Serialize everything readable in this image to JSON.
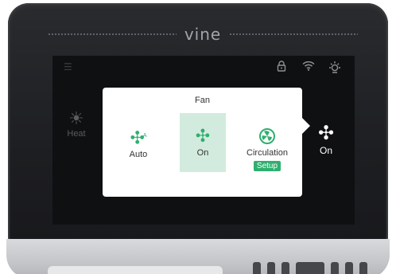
{
  "brand": {
    "name": "vine"
  },
  "status_bar": {
    "icons": [
      "menu-icon",
      "lock-icon",
      "wifi-icon",
      "sun-icon"
    ]
  },
  "left_mode": {
    "label": "Heat",
    "icon": "sun-icon"
  },
  "right_fan": {
    "label": "On",
    "icon": "fan-icon"
  },
  "fan_popup": {
    "title": "Fan",
    "options": [
      {
        "label": "Auto",
        "icon": "fan-auto-icon",
        "selected": false
      },
      {
        "label": "On",
        "icon": "fan-icon",
        "selected": true
      },
      {
        "label": "Circulation",
        "icon": "circulation-icon",
        "selected": false
      }
    ],
    "setup_label": "Setup"
  },
  "colors": {
    "accent": "#2faf6f",
    "selected_bg": "#d2ebde",
    "screen_bg": "#0f1012",
    "bezel": "#222326"
  }
}
